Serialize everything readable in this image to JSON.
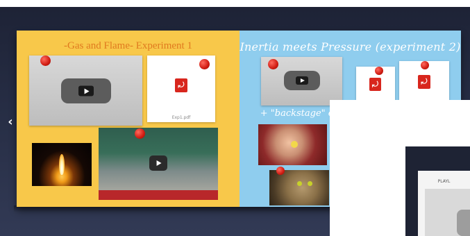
{
  "nav": {
    "prev_icon": "chevron-left-icon",
    "prev_glyph": "‹"
  },
  "left_panel": {
    "title": "-Gas and Flame- Experiment 1",
    "pdf_caption": "Exp1.pdf",
    "pdf_icon": "pdf-icon",
    "video_icon": "play-icon"
  },
  "right_panel": {
    "title": "Inertia meets Pressure (experiment 2)",
    "subtitle": "+ \"backstage\" extra",
    "pdf_icon": "pdf-icon",
    "video_icon": "play-icon"
  },
  "overlay": {
    "card_label": "PLAYL"
  },
  "colors": {
    "left_panel_bg": "#f8c84a",
    "right_panel_bg": "#8fcdee",
    "left_title": "#e07a1f",
    "pin": "#d01c12",
    "pdf": "#d8261d"
  }
}
